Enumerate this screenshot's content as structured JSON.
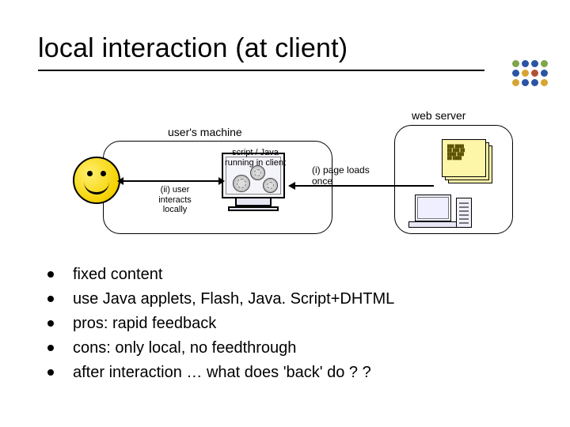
{
  "title": "local interaction (at client)",
  "diagram": {
    "user_machine_label": "user's machine",
    "web_server_label": "web server",
    "script_label": "script / Java running in client",
    "ii_label": "(ii) user interacts locally",
    "i_label": "(i)  page loads once"
  },
  "bullets": [
    "fixed content",
    "use Java applets, Flash, Java. Script+DHTML",
    "pros:  rapid feedback",
    "cons:  only local, no feedthrough",
    "after interaction … what does 'back' do ? ?"
  ]
}
